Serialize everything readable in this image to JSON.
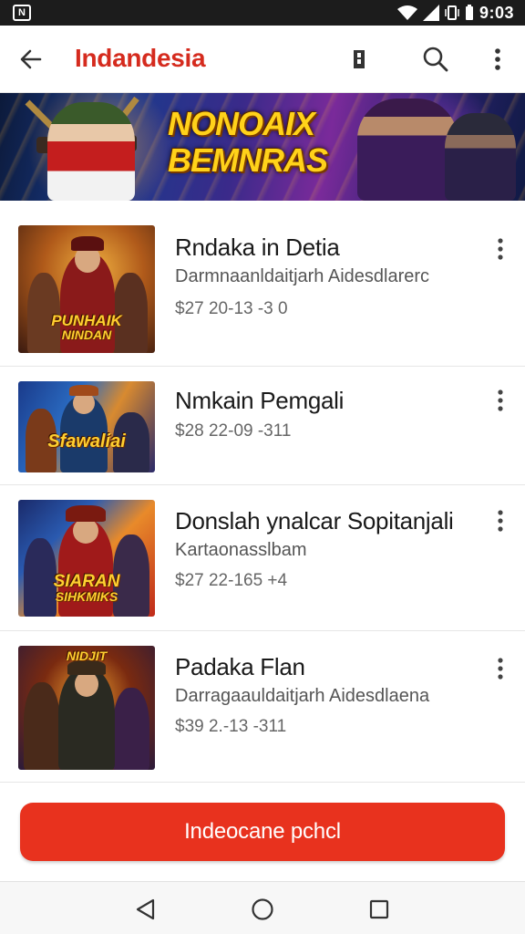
{
  "status_bar": {
    "time": "9:03",
    "left_icon": "notification-n-icon",
    "right_icons": [
      "wifi-icon",
      "signal-icon",
      "vibrate-icon",
      "battery-icon"
    ]
  },
  "app_bar": {
    "title": "Indandesia",
    "title_color": "#d52b1e",
    "icons": [
      "back-arrow-icon",
      "bookmark-icon",
      "search-icon",
      "more-vert-icon"
    ]
  },
  "banner": {
    "title_line1": "NONOAIX",
    "title_line2": "BEMNRAS"
  },
  "games": [
    {
      "title": "Rndaka in Detia",
      "subtitle": "Darmnaanldaitjarh Aidesdlarerc",
      "price": "$27 20-13 -3 0",
      "thumb_text_line1": "PUNHAIK",
      "thumb_text_line2": "NINDAN"
    },
    {
      "title": "Nmkain Pemgali",
      "subtitle": "",
      "price": "$28 22-09 -311",
      "thumb_text_line1": "Sfawaliai",
      "thumb_text_line2": ""
    },
    {
      "title": "Donslah ynalcar Sopitanjali",
      "subtitle": "Kartaonasslbam",
      "price": "$27 22-165 +4",
      "thumb_text_line1": "SIARAN",
      "thumb_text_line2": "SIHKMIKS"
    },
    {
      "title": "Padaka Flan",
      "subtitle": "Darragaauldaitjarh Aidesdlaena",
      "price": "$39 2.-13 -311",
      "thumb_text_line1": "NIDJIT",
      "thumb_text_line2": ""
    }
  ],
  "cta": {
    "label": "Indeocane pchcl",
    "color": "#e8321e"
  },
  "nav_bar": {
    "icons": [
      "nav-back-icon",
      "nav-home-icon",
      "nav-recents-icon"
    ]
  }
}
